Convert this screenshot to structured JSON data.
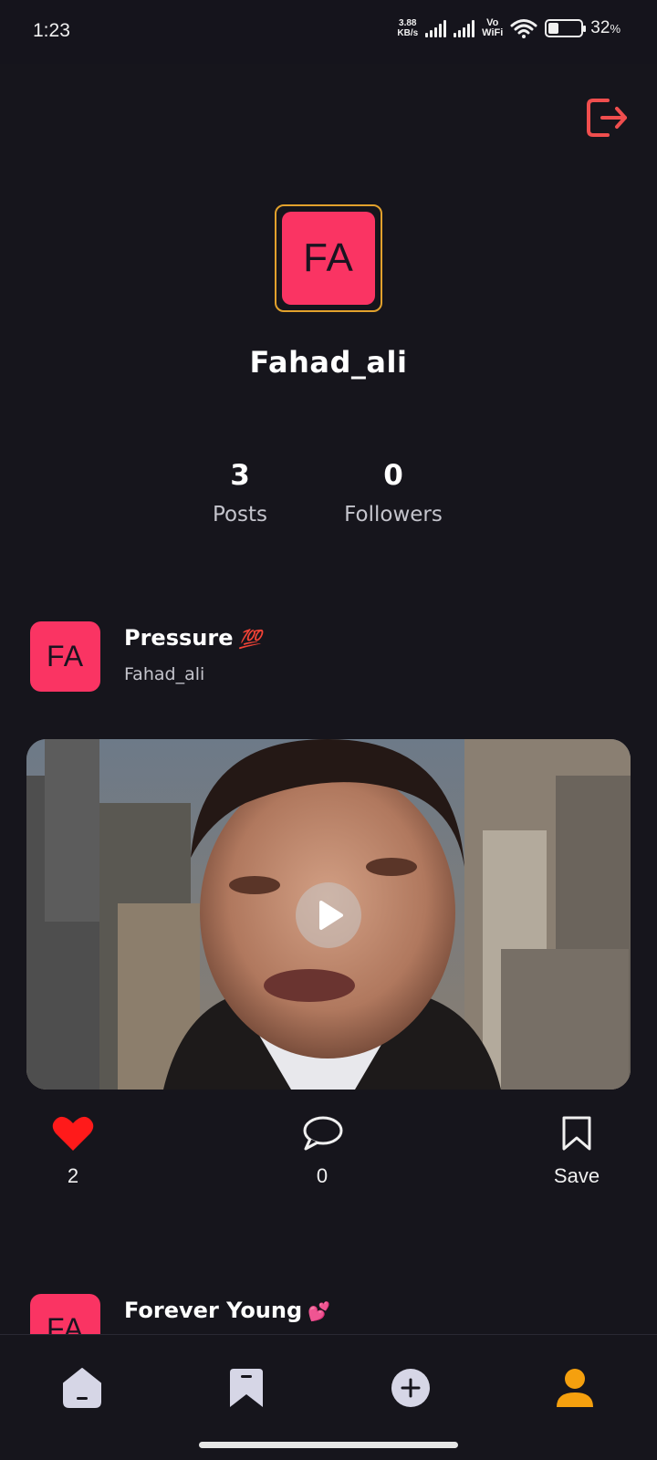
{
  "status_bar": {
    "time": "1:23",
    "net_speed_value": "3.88",
    "net_speed_unit": "KB/s",
    "vo": "Vo",
    "wifi_label": "WiFi",
    "battery_percent": "32",
    "battery_symbol": "%",
    "battery_level": 0.32
  },
  "header": {
    "logout_icon": "logout-icon",
    "accent_color": "#f04e4e"
  },
  "profile": {
    "initials": "FA",
    "username": "Fahad_ali",
    "avatar_color": "#fa3463",
    "avatar_border_color": "#e2a12c",
    "stats": [
      {
        "value": "3",
        "label": "Posts"
      },
      {
        "value": "0",
        "label": "Followers"
      }
    ]
  },
  "posts": [
    {
      "initials": "FA",
      "title": "Pressure",
      "title_emoji": "💯",
      "author": "Fahad_ali",
      "likes": "2",
      "comments": "0",
      "save_label": "Save"
    },
    {
      "initials": "FA",
      "title": "Forever Young",
      "title_emoji": "💕"
    }
  ],
  "bottom_nav": {
    "items": [
      "home-icon",
      "bookmark-icon",
      "add-icon",
      "profile-icon"
    ],
    "active_color": "#f5a00e",
    "inactive_color": "#d6d6e6"
  }
}
